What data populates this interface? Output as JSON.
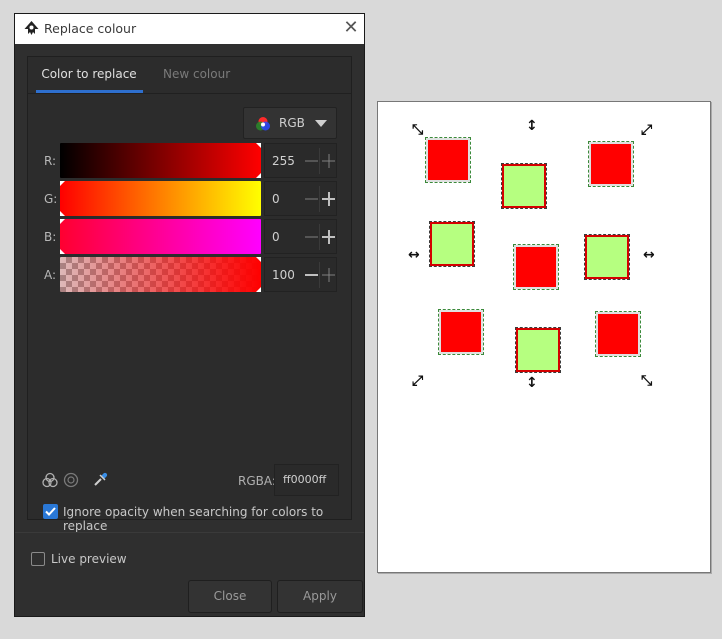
{
  "window": {
    "title": "Replace colour",
    "close_glyph": "✕"
  },
  "tabs": [
    {
      "label": "Color to replace",
      "active": true
    },
    {
      "label": "New colour",
      "active": false
    }
  ],
  "color_mode": {
    "label": "RGB",
    "icon": "rgb-circles-icon"
  },
  "channels": [
    {
      "label": "R:",
      "value": "255"
    },
    {
      "label": "G:",
      "value": "0"
    },
    {
      "label": "B:",
      "value": "0"
    },
    {
      "label": "A:",
      "value": "100"
    }
  ],
  "rgba": {
    "label": "RGBA:",
    "value": "ff0000ff"
  },
  "tools": [
    "color-mixer-icon",
    "color-wheel-icon",
    "eyedropper-icon"
  ],
  "options": {
    "ignore_opacity_label": "Ignore opacity when searching for colors to replace",
    "ignore_opacity_checked": true,
    "live_preview_label": "Live preview",
    "live_preview_checked": false
  },
  "buttons": {
    "close": "Close",
    "apply": "Apply"
  },
  "colors": {
    "accent": "#2e6fce",
    "target_red": "#ff0000",
    "fill_green": "#b6ff80",
    "stroke_red": "#d40000"
  }
}
